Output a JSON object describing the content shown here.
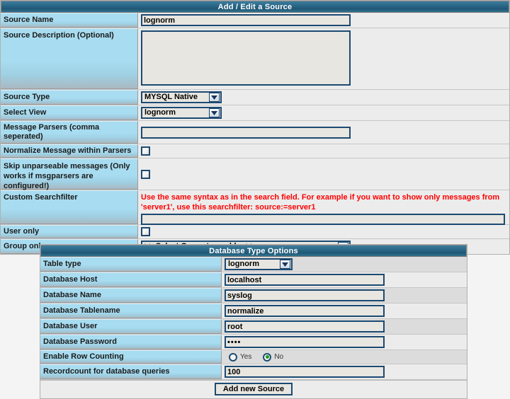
{
  "source_panel": {
    "title": "Add / Edit a Source",
    "rows": {
      "source_name": {
        "label": "Source Name",
        "value": "lognorm"
      },
      "source_description": {
        "label": "Source Description (Optional)",
        "value": "",
        "placeholder": ""
      },
      "source_type": {
        "label": "Source Type",
        "value": "MYSQL Native"
      },
      "select_view": {
        "label": "Select View",
        "value": "lognorm"
      },
      "message_parsers": {
        "label": "Message Parsers (comma seperated)",
        "value": "",
        "placeholder": ""
      },
      "normalize_message": {
        "label": "Normalize Message within Parsers",
        "checked": false
      },
      "skip_unparseable": {
        "label": "Skip unparseable messages (Only works if msgparsers are configured!)",
        "checked": false
      },
      "custom_searchfilter": {
        "label": "Custom Searchfilter",
        "hint": "Use the same syntax as in the search field. For example if you want to show only messages from 'server1', use this searchfilter: source:=server1",
        "value": "",
        "placeholder": ""
      },
      "user_only": {
        "label": "User only",
        "checked": false
      },
      "group_only": {
        "label": "Group only",
        "value": ">> Select Group to enable <<"
      }
    }
  },
  "db_panel": {
    "title": "Database Type Options",
    "rows": {
      "table_type": {
        "label": "Table type",
        "value": "lognorm"
      },
      "database_host": {
        "label": "Database Host",
        "value": "localhost"
      },
      "database_name": {
        "label": "Database Name",
        "value": "syslog"
      },
      "database_tablename": {
        "label": "Database Tablename",
        "value": "normalize"
      },
      "database_user": {
        "label": "Database User",
        "value": "root"
      },
      "database_password": {
        "label": "Database Password",
        "value": "••••"
      },
      "enable_row_counting": {
        "label": "Enable Row Counting",
        "options": [
          "Yes",
          "No"
        ],
        "selected": "No"
      },
      "recordcount": {
        "label": "Recordcount for database queries",
        "value": "100"
      }
    },
    "submit_label": "Add new Source"
  },
  "icons": {
    "dropdown": "chevron-down-icon"
  },
  "colors": {
    "title_bar": "#2d6a8a",
    "label_cell": "#a8dcf0",
    "field_border": "#1c4a72",
    "field_bg": "#e8e6e0",
    "hint_text": "#ff0000",
    "radio_selected": "#19a01e"
  }
}
